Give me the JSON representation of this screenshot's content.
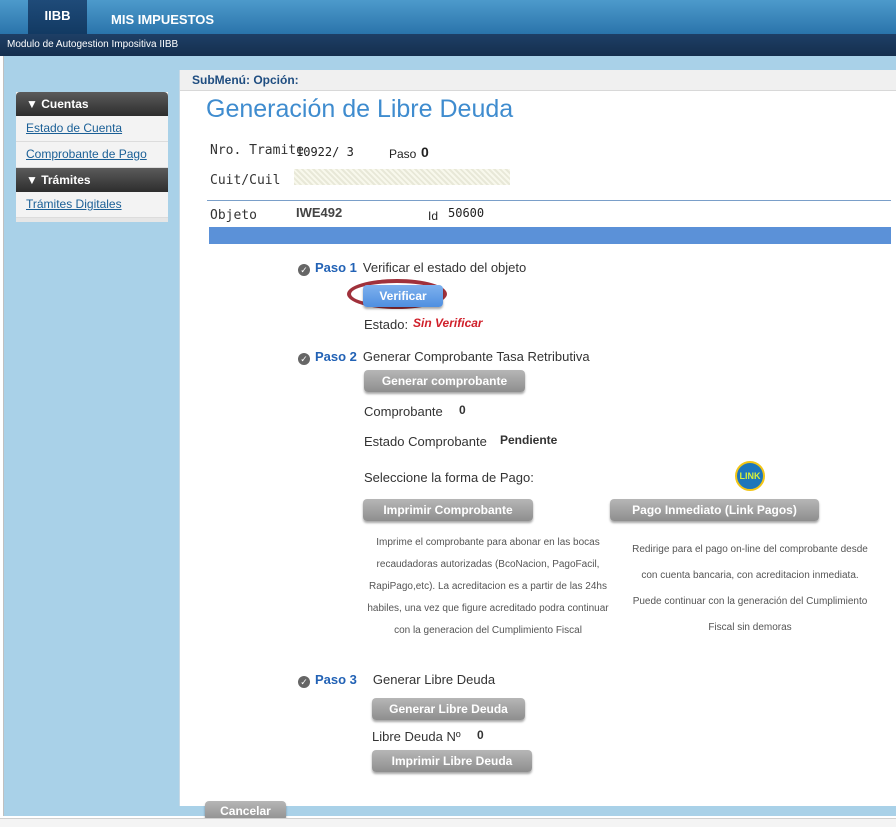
{
  "topbar": {
    "tab_active": "IIBB",
    "tab_other": "MIS IMPUESTOS"
  },
  "subbar": {
    "module_title": "Modulo de Autogestion Impositiva IIBB"
  },
  "sidebar": {
    "section1": "▼ Cuentas",
    "items1": [
      "Estado de Cuenta",
      "Comprobante de Pago"
    ],
    "section2": "▼ Trámites",
    "items2": [
      "Trámites Digitales"
    ]
  },
  "content": {
    "submenu": "SubMenú: Opción:",
    "title": "Generación de Libre Deuda",
    "nro_tramite_label": "Nro. Tramite",
    "nro_tramite_value": "10922/ 3",
    "paso_label": "Paso",
    "paso_value": "0",
    "cuit_label": "Cuit/Cuil",
    "objeto_label": "Objeto",
    "objeto_value": "IWE492",
    "id_label": "Id",
    "id_value": "50600"
  },
  "paso1": {
    "num": "Paso 1",
    "title": "Verificar el estado del objeto",
    "button": "Verificar",
    "estado_label": "Estado:",
    "estado_value": "Sin Verificar"
  },
  "paso2": {
    "num": "Paso 2",
    "title": "Generar Comprobante Tasa Retributiva",
    "button": "Generar comprobante",
    "comprobante_label": "Comprobante",
    "comprobante_value": "0",
    "estado_comp_label": "Estado Comprobante",
    "estado_comp_value": "Pendiente",
    "forma_pago_label": "Seleccione la forma de Pago:",
    "link_logo": "LINK",
    "btn_imprimir": "Imprimir Comprobante",
    "btn_pago": "Pago Inmediato (Link Pagos)",
    "desc_imprimir": [
      "Imprime el comprobante para abonar en las bocas",
      "recaudadoras autorizadas (BcoNacion, PagoFacil,",
      "RapiPago,etc). La acreditacion es a partir de las 24hs",
      "habiles, una vez que figure acreditado podra continuar",
      "con la generacion del Cumplimiento Fiscal"
    ],
    "desc_pago": [
      "Redirige para el pago on-line del comprobante desde",
      "con cuenta bancaria, con acreditacion inmediata.",
      "Puede continuar con la generación del Cumplimiento",
      "Fiscal sin demoras"
    ]
  },
  "paso3": {
    "num": "Paso 3",
    "title": "Generar Libre Deuda",
    "button": "Generar Libre Deuda",
    "libre_label": "Libre Deuda Nº",
    "libre_value": "0",
    "btn_imprimir": "Imprimir Libre Deuda"
  },
  "footer": {
    "cancel": "Cancelar"
  },
  "colors": {
    "accent_blue": "#3f8ccf",
    "estado_red": "#d0202b",
    "header_dark": "#123a63"
  }
}
